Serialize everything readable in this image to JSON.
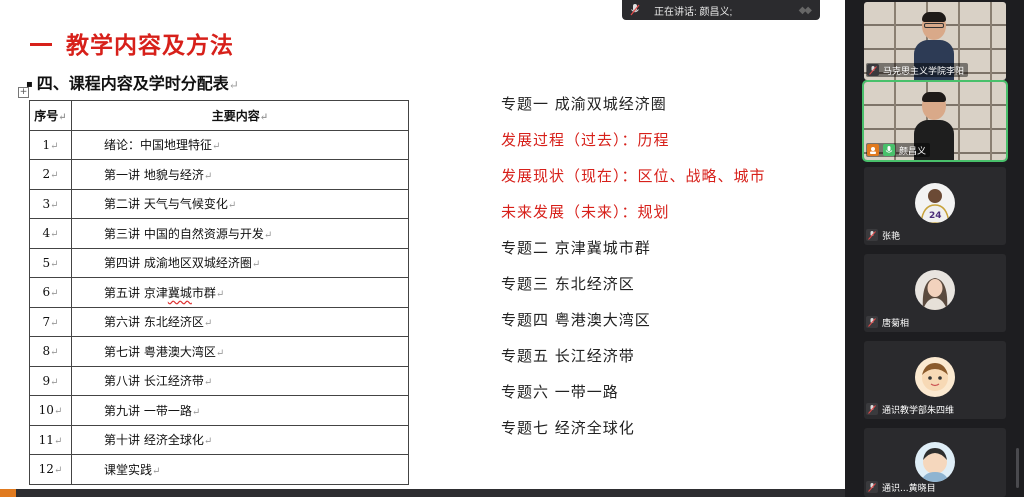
{
  "speaker_bar": {
    "label": "正在讲话: 颜昌义;"
  },
  "slide": {
    "title": "教学内容及方法",
    "subheading": "四、课程内容及学时分配表",
    "subheading_bullet": "▪",
    "para_mark": "↵",
    "table": {
      "headers": [
        "序号",
        "主要内容"
      ],
      "rows": [
        {
          "no": "1",
          "content": "绪论：中国地理特征"
        },
        {
          "no": "2",
          "content": "第一讲  地貌与经济"
        },
        {
          "no": "3",
          "content": "第二讲  天气与气候变化"
        },
        {
          "no": "4",
          "content": "第三讲  中国的自然资源与开发"
        },
        {
          "no": "5",
          "content": "第四讲  成渝地区双城经济圈"
        },
        {
          "no": "6",
          "content_pre": "第五讲  京津",
          "content_squiggle": "冀城",
          "content_post": "市群"
        },
        {
          "no": "7",
          "content": "第六讲  东北经济区"
        },
        {
          "no": "8",
          "content": "第七讲  粤港澳大湾区"
        },
        {
          "no": "9",
          "content": "第八讲  长江经济带"
        },
        {
          "no": "10",
          "content": "第九讲  一带一路"
        },
        {
          "no": "11",
          "content": "第十讲  经济全球化"
        },
        {
          "no": "12",
          "content": "课堂实践"
        }
      ]
    },
    "topics": [
      {
        "text": "专题一  成渝双城经济圈",
        "color": "#222222"
      },
      {
        "text": "发展过程（过去）：历程",
        "color": "#d7201a"
      },
      {
        "text": "发展现状（现在）：区位、战略、城市",
        "color": "#d7201a"
      },
      {
        "text": "未来发展（未来）：规划",
        "color": "#d7201a"
      },
      {
        "text": "专题二  京津冀城市群",
        "color": "#222222"
      },
      {
        "text": "专题三  东北经济区",
        "color": "#222222"
      },
      {
        "text": "专题四  粤港澳大湾区",
        "color": "#222222"
      },
      {
        "text": "专题五  长江经济带",
        "color": "#222222"
      },
      {
        "text": "专题六  一带一路",
        "color": "#222222"
      },
      {
        "text": "专题七  经济全球化",
        "color": "#222222"
      }
    ]
  },
  "participants": [
    {
      "name": "马克思主义学院李阳",
      "kind": "video",
      "icon": "mic-muted-icon"
    },
    {
      "name": "颜昌义",
      "kind": "video",
      "icon": "mic-active-icon",
      "active": true
    },
    {
      "name": "张艳",
      "kind": "avatar",
      "icon": "mic-muted-icon"
    },
    {
      "name": "唐菊相",
      "kind": "avatar",
      "icon": "mic-muted-icon"
    },
    {
      "name": "通识教学部朱四维",
      "kind": "avatar",
      "icon": "mic-muted-icon"
    },
    {
      "name": "通识...黄晓目",
      "kind": "avatar",
      "icon": "mic-muted-icon"
    }
  ],
  "colors": {
    "accent_red": "#d7201a",
    "active_green": "#49c06b"
  }
}
